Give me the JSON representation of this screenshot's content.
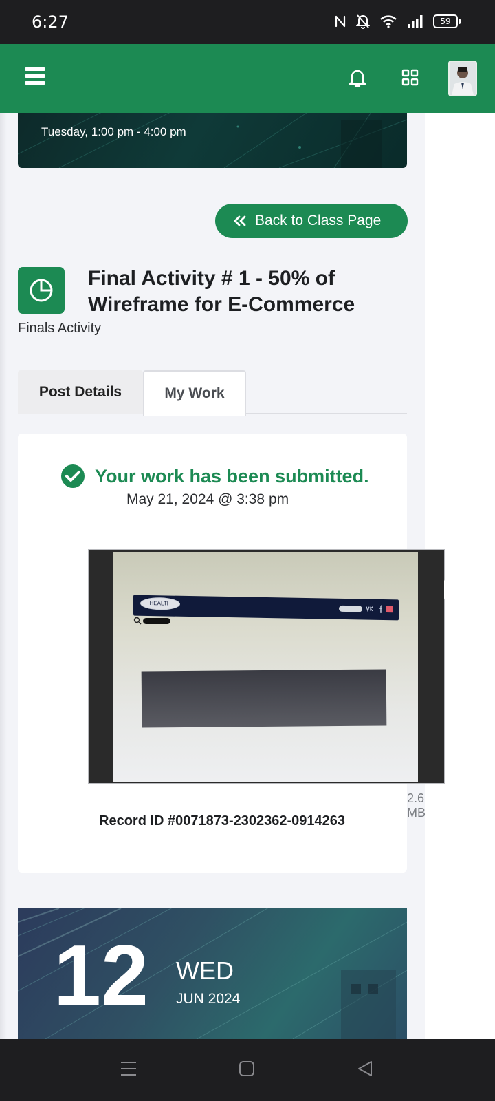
{
  "status_bar": {
    "time": "6:27",
    "battery": "59"
  },
  "header": {
    "menu_icon": "hamburger-icon",
    "notification_icon": "bell-icon",
    "apps_icon": "grid-icon",
    "accent_color": "#1c8a53"
  },
  "schedule": {
    "text": "Tuesday, 1:00 pm - 4:00 pm"
  },
  "back_button": {
    "label": "Back to Class Page",
    "icon": "double-chevron-left-icon"
  },
  "activity": {
    "icon": "pie-chart-icon",
    "title": "Final Activity # 1 - 50% of Wireframe for E-Commerce",
    "category": "Finals Activity"
  },
  "tabs": [
    {
      "label": "Post Details"
    },
    {
      "label": "My Work",
      "active": true
    }
  ],
  "submission": {
    "status": "Your work has been submitted.",
    "date": "May 21, 2024 @ 3:38 pm",
    "file_size": "2.6 MB",
    "record_id": "Record ID #0071873-2302362-0914263",
    "status_color": "#1c8a53"
  },
  "attachment_preview": {
    "logo_text": "HEALTH"
  },
  "date_card": {
    "day": "12",
    "weekday": "WED",
    "month_year": "JUN 2024"
  }
}
